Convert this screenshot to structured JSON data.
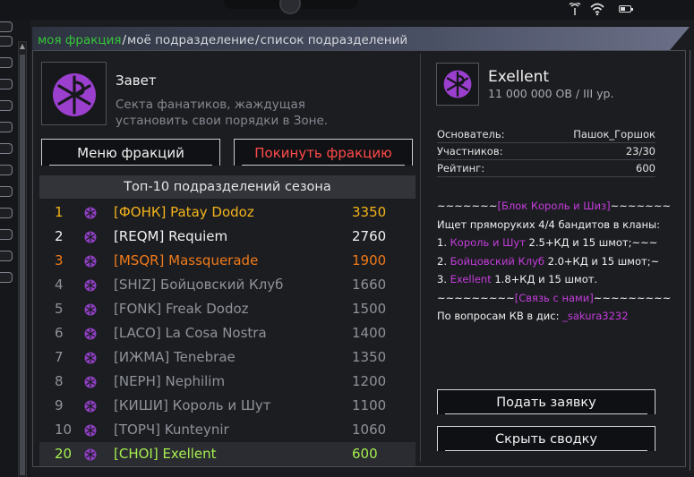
{
  "breadcrumbs": [
    {
      "label": "моя фракция",
      "active": true
    },
    {
      "label": "моё подразделение",
      "active": false
    },
    {
      "label": "список подразделений",
      "active": false
    }
  ],
  "faction": {
    "name": "Завет",
    "description": "Секта фанатиков, жаждущая установить свои порядки в Зоне.",
    "menu_button": "Меню фракций",
    "leave_button": "Покинуть фракцию"
  },
  "top_list": {
    "header": "Топ-10 подразделений сезона",
    "rows": [
      {
        "rank": "1",
        "name": "[ФОНК] Patay Dodoz",
        "score": "3350",
        "style": "gold"
      },
      {
        "rank": "2",
        "name": "[REQM] Requiem",
        "score": "2760",
        "style": "white"
      },
      {
        "rank": "3",
        "name": "[MSQR] Massquerade",
        "score": "1900",
        "style": "orange"
      },
      {
        "rank": "4",
        "name": "[SHIZ] Бойцовский Клуб",
        "score": "1660",
        "style": "grey"
      },
      {
        "rank": "5",
        "name": "[FONK] Freak Dodoz",
        "score": "1500",
        "style": "grey"
      },
      {
        "rank": "6",
        "name": "[LACO] La Cosa Nostra",
        "score": "1400",
        "style": "grey"
      },
      {
        "rank": "7",
        "name": "[ИЖМА] Tenebrae",
        "score": "1350",
        "style": "grey"
      },
      {
        "rank": "8",
        "name": "[NEPH] Nephilim",
        "score": "1200",
        "style": "grey"
      },
      {
        "rank": "9",
        "name": "[КИШИ] Король и Шут",
        "score": "1100",
        "style": "grey"
      },
      {
        "rank": "10",
        "name": "[ТОРЧ] Kunteynir",
        "score": "1060",
        "style": "grey"
      },
      {
        "rank": "20",
        "name": "[CHOI] Exellent",
        "score": "600",
        "style": "green"
      }
    ]
  },
  "squad": {
    "name": "Exellent",
    "subtitle": "11 000 000 ОВ / III ур.",
    "stats": [
      {
        "label": "Основатель:",
        "value": "Пашок_Горшок"
      },
      {
        "label": "Участников:",
        "value": "23/30"
      },
      {
        "label": "Рейтинг:",
        "value": "600"
      }
    ],
    "ad_lines": [
      [
        {
          "t": "~~~~~~~",
          "c": "wht"
        },
        {
          "t": "[Блок Король и Шиз]",
          "c": "mag"
        },
        {
          "t": "~~~~~~~",
          "c": "wht"
        }
      ],
      [
        {
          "t": "Ищет пряморуких 4/4 бандитов в кланы:",
          "c": "wht"
        }
      ],
      [
        {
          "t": "1. ",
          "c": "wht"
        },
        {
          "t": "Король и Шут",
          "c": "mag"
        },
        {
          "t": " 2.5+КД и 15 шмот;~~~",
          "c": "wht"
        }
      ],
      [
        {
          "t": "2. ",
          "c": "wht"
        },
        {
          "t": "Бойцовский Клуб",
          "c": "mag"
        },
        {
          "t": " 2.0+КД и 15 шмот;~",
          "c": "wht"
        }
      ],
      [
        {
          "t": "3. ",
          "c": "wht"
        },
        {
          "t": "Exellent",
          "c": "mag"
        },
        {
          "t": " 1.8+КД и 15 шмот.",
          "c": "wht"
        }
      ],
      [
        {
          "t": "~~~~~~~~~",
          "c": "wht"
        },
        {
          "t": "[Связь с нами]",
          "c": "mag"
        },
        {
          "t": "~~~~~~~~~",
          "c": "wht"
        }
      ],
      [
        {
          "t": "По вопросам КВ в дис: ",
          "c": "wht"
        },
        {
          "t": "_sakura3232",
          "c": "mag"
        }
      ]
    ],
    "apply_button": "Подать заявку",
    "hide_button": "Скрыть сводку"
  },
  "system": {
    "battery_level": 0.5,
    "icons": [
      "signal-icon",
      "wifi-icon",
      "battery-icon"
    ]
  },
  "colors": {
    "accent_green": "#35c53a",
    "emblem_purple": "#9b3fcf",
    "danger_red": "#ff4a4a"
  }
}
